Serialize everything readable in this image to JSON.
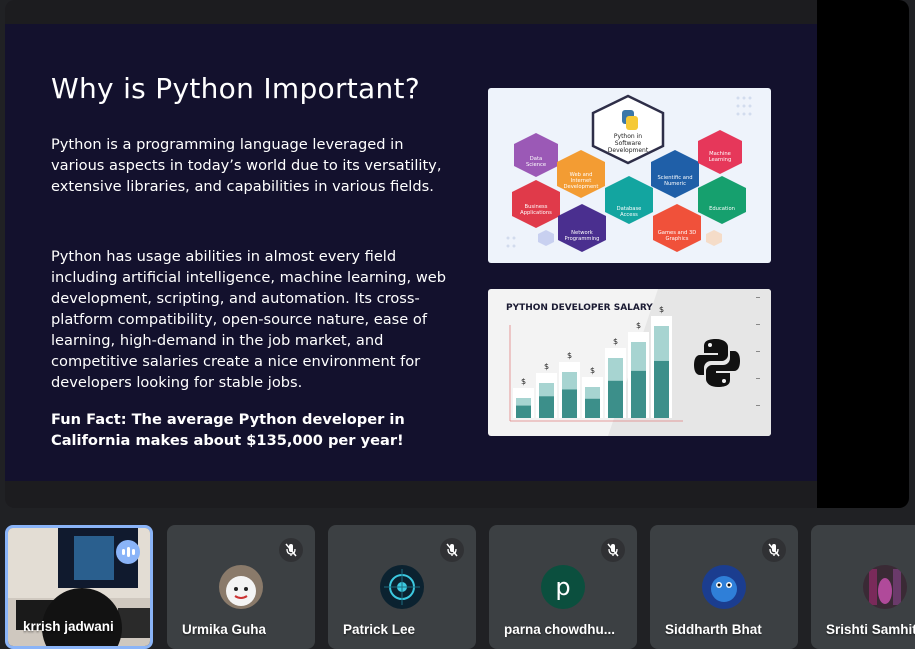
{
  "slide": {
    "title": "Why is Python Important?",
    "paragraph_1": "Python is a programming language leveraged in various aspects in today’s world due to its versatility, extensive libraries, and capabilities in various fields.",
    "paragraph_2": "Python has usage abilities in almost every field including artificial intelligence, machine learning, web development, scripting, and automation. Its cross-platform compatibility, open-source nature, ease of learning, high-demand in the job market, and competitive salaries create a nice environment for developers looking for stable jobs.",
    "fun_fact": "Fun Fact: The average Python developer in California makes about $135,000 per year!",
    "hex_diagram": {
      "center": "Python in Software Development",
      "items": [
        "Data Science",
        "Web and Internet Development",
        "Scientific and Numeric",
        "Machine Learning",
        "Business Applications",
        "Network Programming",
        "Database Access",
        "Games and 3D Graphics",
        "Education"
      ]
    },
    "salary_chart": {
      "title": "PYTHON DEVELOPER SALARY",
      "bar_label": "$"
    }
  },
  "participants": [
    {
      "name": "krrish jadwani",
      "speaking": true
    },
    {
      "name": "Urmika Guha",
      "muted": true
    },
    {
      "name": "Patrick Lee",
      "muted": true
    },
    {
      "name": "parna chowdhu...",
      "muted": true,
      "initial": "p"
    },
    {
      "name": "Siddharth Bhat",
      "muted": true
    },
    {
      "name": "Srishti Samhita",
      "muted": true
    }
  ],
  "colors": {
    "slide_bg": "#13112d",
    "active_tile_border": "#8ab4f8",
    "tile_bg": "#3c4043"
  }
}
